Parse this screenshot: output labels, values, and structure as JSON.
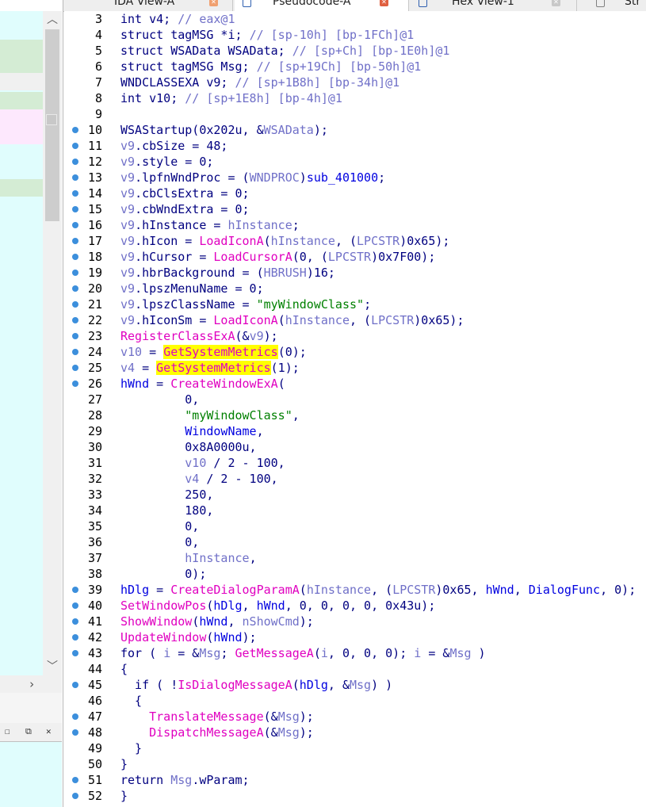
{
  "tabs": [
    {
      "label": "IDA View-A",
      "icon": "ida-view-icon"
    },
    {
      "label": "Pseudocode-A",
      "icon": "pseudocode-icon"
    },
    {
      "label": "Hex View-1",
      "icon": "hex-view-icon"
    },
    {
      "label": "Str",
      "icon": "strings-icon"
    }
  ],
  "colors": {
    "keyword": "#000080",
    "local_var": "#7070c8",
    "library_func": "#e000c0",
    "global": "#0000e0",
    "string": "#008000",
    "highlight": "#ffff00",
    "breakpoint_dot": "#3c8fdc",
    "function_list_bg": "#e0fdfd"
  },
  "code_lines": [
    {
      "n": "3",
      "bp": false,
      "tokens": [
        [
          "t",
          "int v4; "
        ],
        [
          "cmt",
          "// eax@1"
        ]
      ]
    },
    {
      "n": "4",
      "bp": false,
      "tokens": [
        [
          "t",
          "struct tagMSG *i; "
        ],
        [
          "cmt",
          "// [sp-10h] [bp-1FCh]@1"
        ]
      ]
    },
    {
      "n": "5",
      "bp": false,
      "tokens": [
        [
          "t",
          "struct WSAData WSAData; "
        ],
        [
          "cmt",
          "// [sp+Ch] [bp-1E0h]@1"
        ]
      ]
    },
    {
      "n": "6",
      "bp": false,
      "tokens": [
        [
          "t",
          "struct tagMSG Msg; "
        ],
        [
          "cmt",
          "// [sp+19Ch] [bp-50h]@1"
        ]
      ]
    },
    {
      "n": "7",
      "bp": false,
      "tokens": [
        [
          "t",
          "WNDCLASSEXA v9; "
        ],
        [
          "cmt",
          "// [sp+1B8h] [bp-34h]@1"
        ]
      ]
    },
    {
      "n": "8",
      "bp": false,
      "tokens": [
        [
          "t",
          "int v10; "
        ],
        [
          "cmt",
          "// [sp+1E8h] [bp-4h]@1"
        ]
      ]
    },
    {
      "n": "9",
      "bp": false,
      "tokens": []
    },
    {
      "n": "10",
      "bp": true,
      "tokens": [
        [
          "p",
          "WSAStartup(0x202u, &"
        ],
        [
          "var",
          "WSAData"
        ],
        [
          "p",
          ");"
        ]
      ]
    },
    {
      "n": "11",
      "bp": true,
      "tokens": [
        [
          "var",
          "v9"
        ],
        [
          "p",
          ".cbSize = 48;"
        ]
      ]
    },
    {
      "n": "12",
      "bp": true,
      "tokens": [
        [
          "var",
          "v9"
        ],
        [
          "p",
          ".style = 0;"
        ]
      ]
    },
    {
      "n": "13",
      "bp": true,
      "tokens": [
        [
          "var",
          "v9"
        ],
        [
          "p",
          ".lpfnWndProc = ("
        ],
        [
          "var",
          "WNDPROC"
        ],
        [
          "p",
          ")"
        ],
        [
          "glob",
          "sub_401000"
        ],
        [
          "p",
          ";"
        ]
      ]
    },
    {
      "n": "14",
      "bp": true,
      "tokens": [
        [
          "var",
          "v9"
        ],
        [
          "p",
          ".cbClsExtra = 0;"
        ]
      ]
    },
    {
      "n": "15",
      "bp": true,
      "tokens": [
        [
          "var",
          "v9"
        ],
        [
          "p",
          ".cbWndExtra = 0;"
        ]
      ]
    },
    {
      "n": "16",
      "bp": true,
      "tokens": [
        [
          "var",
          "v9"
        ],
        [
          "p",
          ".hInstance = "
        ],
        [
          "var",
          "hInstance"
        ],
        [
          "p",
          ";"
        ]
      ]
    },
    {
      "n": "17",
      "bp": true,
      "tokens": [
        [
          "var",
          "v9"
        ],
        [
          "p",
          ".hIcon = "
        ],
        [
          "lib",
          "LoadIconA"
        ],
        [
          "p",
          "("
        ],
        [
          "var",
          "hInstance"
        ],
        [
          "p",
          ", ("
        ],
        [
          "var",
          "LPCSTR"
        ],
        [
          "p",
          ")0x65);"
        ]
      ]
    },
    {
      "n": "18",
      "bp": true,
      "tokens": [
        [
          "var",
          "v9"
        ],
        [
          "p",
          ".hCursor = "
        ],
        [
          "lib",
          "LoadCursorA"
        ],
        [
          "p",
          "(0, ("
        ],
        [
          "var",
          "LPCSTR"
        ],
        [
          "p",
          ")0x7F00);"
        ]
      ]
    },
    {
      "n": "19",
      "bp": true,
      "tokens": [
        [
          "var",
          "v9"
        ],
        [
          "p",
          ".hbrBackground = ("
        ],
        [
          "var",
          "HBRUSH"
        ],
        [
          "p",
          ")16;"
        ]
      ]
    },
    {
      "n": "20",
      "bp": true,
      "tokens": [
        [
          "var",
          "v9"
        ],
        [
          "p",
          ".lpszMenuName = 0;"
        ]
      ]
    },
    {
      "n": "21",
      "bp": true,
      "tokens": [
        [
          "var",
          "v9"
        ],
        [
          "p",
          ".lpszClassName = "
        ],
        [
          "str",
          "\"myWindowClass\""
        ],
        [
          "p",
          ";"
        ]
      ]
    },
    {
      "n": "22",
      "bp": true,
      "tokens": [
        [
          "var",
          "v9"
        ],
        [
          "p",
          ".hIconSm = "
        ],
        [
          "lib",
          "LoadIconA"
        ],
        [
          "p",
          "("
        ],
        [
          "var",
          "hInstance"
        ],
        [
          "p",
          ", ("
        ],
        [
          "var",
          "LPCSTR"
        ],
        [
          "p",
          ")0x65);"
        ]
      ]
    },
    {
      "n": "23",
      "bp": true,
      "tokens": [
        [
          "lib",
          "RegisterClassExA"
        ],
        [
          "p",
          "(&"
        ],
        [
          "var",
          "v9"
        ],
        [
          "p",
          ");"
        ]
      ]
    },
    {
      "n": "24",
      "bp": true,
      "tokens": [
        [
          "var",
          "v10"
        ],
        [
          "p",
          " = "
        ],
        [
          "hl",
          "GetSystemMetrics"
        ],
        [
          "p",
          "(0);"
        ]
      ]
    },
    {
      "n": "25",
      "bp": true,
      "tokens": [
        [
          "var",
          "v4"
        ],
        [
          "p",
          " = "
        ],
        [
          "hl",
          "GetSystemMetrics"
        ],
        [
          "p",
          "(1);"
        ]
      ]
    },
    {
      "n": "26",
      "bp": true,
      "tokens": [
        [
          "glob",
          "hWnd"
        ],
        [
          "p",
          " = "
        ],
        [
          "lib",
          "CreateWindowExA"
        ],
        [
          "p",
          "("
        ]
      ]
    },
    {
      "n": "27",
      "bp": false,
      "tokens": [
        [
          "p",
          "         0,"
        ]
      ]
    },
    {
      "n": "28",
      "bp": false,
      "tokens": [
        [
          "p",
          "         "
        ],
        [
          "str",
          "\"myWindowClass\""
        ],
        [
          "p",
          ","
        ]
      ]
    },
    {
      "n": "29",
      "bp": false,
      "tokens": [
        [
          "p",
          "         "
        ],
        [
          "glob",
          "WindowName"
        ],
        [
          "p",
          ","
        ]
      ]
    },
    {
      "n": "30",
      "bp": false,
      "tokens": [
        [
          "p",
          "         0x8A0000u,"
        ]
      ]
    },
    {
      "n": "31",
      "bp": false,
      "tokens": [
        [
          "p",
          "         "
        ],
        [
          "var",
          "v10"
        ],
        [
          "p",
          " / 2 - 100,"
        ]
      ]
    },
    {
      "n": "32",
      "bp": false,
      "tokens": [
        [
          "p",
          "         "
        ],
        [
          "var",
          "v4"
        ],
        [
          "p",
          " / 2 - 100,"
        ]
      ]
    },
    {
      "n": "33",
      "bp": false,
      "tokens": [
        [
          "p",
          "         250,"
        ]
      ]
    },
    {
      "n": "34",
      "bp": false,
      "tokens": [
        [
          "p",
          "         180,"
        ]
      ]
    },
    {
      "n": "35",
      "bp": false,
      "tokens": [
        [
          "p",
          "         0,"
        ]
      ]
    },
    {
      "n": "36",
      "bp": false,
      "tokens": [
        [
          "p",
          "         0,"
        ]
      ]
    },
    {
      "n": "37",
      "bp": false,
      "tokens": [
        [
          "p",
          "         "
        ],
        [
          "var",
          "hInstance"
        ],
        [
          "p",
          ","
        ]
      ]
    },
    {
      "n": "38",
      "bp": false,
      "tokens": [
        [
          "p",
          "         0);"
        ]
      ]
    },
    {
      "n": "39",
      "bp": true,
      "tokens": [
        [
          "glob",
          "hDlg"
        ],
        [
          "p",
          " = "
        ],
        [
          "lib",
          "CreateDialogParamA"
        ],
        [
          "p",
          "("
        ],
        [
          "var",
          "hInstance"
        ],
        [
          "p",
          ", ("
        ],
        [
          "var",
          "LPCSTR"
        ],
        [
          "p",
          ")0x65, "
        ],
        [
          "glob",
          "hWnd"
        ],
        [
          "p",
          ", "
        ],
        [
          "glob",
          "DialogFunc"
        ],
        [
          "p",
          ", 0);"
        ]
      ]
    },
    {
      "n": "40",
      "bp": true,
      "tokens": [
        [
          "lib",
          "SetWindowPos"
        ],
        [
          "p",
          "("
        ],
        [
          "glob",
          "hDlg"
        ],
        [
          "p",
          ", "
        ],
        [
          "glob",
          "hWnd"
        ],
        [
          "p",
          ", 0, 0, 0, 0, 0x43u);"
        ]
      ]
    },
    {
      "n": "41",
      "bp": true,
      "tokens": [
        [
          "lib",
          "ShowWindow"
        ],
        [
          "p",
          "("
        ],
        [
          "glob",
          "hWnd"
        ],
        [
          "p",
          ", "
        ],
        [
          "var",
          "nShowCmd"
        ],
        [
          "p",
          ");"
        ]
      ]
    },
    {
      "n": "42",
      "bp": true,
      "tokens": [
        [
          "lib",
          "UpdateWindow"
        ],
        [
          "p",
          "("
        ],
        [
          "glob",
          "hWnd"
        ],
        [
          "p",
          ");"
        ]
      ]
    },
    {
      "n": "43",
      "bp": true,
      "tokens": [
        [
          "p",
          "for ( "
        ],
        [
          "var",
          "i"
        ],
        [
          "p",
          " = &"
        ],
        [
          "var",
          "Msg"
        ],
        [
          "p",
          "; "
        ],
        [
          "lib",
          "GetMessageA"
        ],
        [
          "p",
          "("
        ],
        [
          "var",
          "i"
        ],
        [
          "p",
          ", 0, 0, 0); "
        ],
        [
          "var",
          "i"
        ],
        [
          "p",
          " = &"
        ],
        [
          "var",
          "Msg"
        ],
        [
          "p",
          " )"
        ]
      ]
    },
    {
      "n": "44",
      "bp": false,
      "tokens": [
        [
          "p",
          "{"
        ]
      ]
    },
    {
      "n": "45",
      "bp": true,
      "tokens": [
        [
          "p",
          "  if ( !"
        ],
        [
          "lib",
          "IsDialogMessageA"
        ],
        [
          "p",
          "("
        ],
        [
          "glob",
          "hDlg"
        ],
        [
          "p",
          ", &"
        ],
        [
          "var",
          "Msg"
        ],
        [
          "p",
          ") )"
        ]
      ]
    },
    {
      "n": "46",
      "bp": false,
      "tokens": [
        [
          "p",
          "  {"
        ]
      ]
    },
    {
      "n": "47",
      "bp": true,
      "tokens": [
        [
          "p",
          "    "
        ],
        [
          "lib",
          "TranslateMessage"
        ],
        [
          "p",
          "(&"
        ],
        [
          "var",
          "Msg"
        ],
        [
          "p",
          ");"
        ]
      ]
    },
    {
      "n": "48",
      "bp": true,
      "tokens": [
        [
          "p",
          "    "
        ],
        [
          "lib",
          "DispatchMessageA"
        ],
        [
          "p",
          "(&"
        ],
        [
          "var",
          "Msg"
        ],
        [
          "p",
          ");"
        ]
      ]
    },
    {
      "n": "49",
      "bp": false,
      "tokens": [
        [
          "p",
          "  }"
        ]
      ]
    },
    {
      "n": "50",
      "bp": false,
      "tokens": [
        [
          "p",
          "}"
        ]
      ]
    },
    {
      "n": "51",
      "bp": true,
      "tokens": [
        [
          "p",
          "return "
        ],
        [
          "var",
          "Msg"
        ],
        [
          "p",
          ".wParam;"
        ]
      ]
    },
    {
      "n": "52",
      "bp": true,
      "tokens": [
        [
          "p",
          "}"
        ]
      ]
    }
  ]
}
